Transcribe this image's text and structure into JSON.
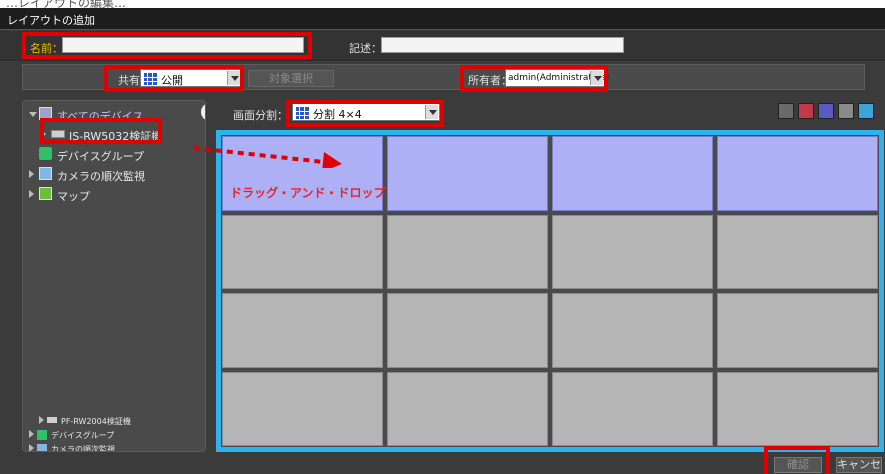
{
  "window": {
    "title": "レイアウトの追加"
  },
  "top_caption": "…レイアウトの編集…",
  "form": {
    "name_label": "名前：",
    "name_value": "",
    "description_label": "記述：",
    "description_value": "",
    "share_label": "共有：",
    "share_value": "公開",
    "target_button": "対象選択",
    "owner_label": "所有者：",
    "owner_value": "admin(Administrators)"
  },
  "tree": {
    "items": [
      {
        "label": "すべてのデバイス",
        "icon": "server-icon",
        "expanded": true
      },
      {
        "label": "JS-RW5032検証機",
        "icon": "camera-device-icon"
      },
      {
        "label": "デバイスグループ",
        "icon": "cube-icon"
      },
      {
        "label": "カメラの順次監視",
        "icon": "sequence-icon"
      },
      {
        "label": "マップ",
        "icon": "map-icon"
      }
    ],
    "bottom_items": [
      {
        "label": "PF-RW2004検証機",
        "icon": "camera-device-icon"
      },
      {
        "label": "デバイスグループ",
        "icon": "cube-icon"
      },
      {
        "label": "カメラの順次監視",
        "icon": "sequence-icon"
      }
    ]
  },
  "layout": {
    "split_label": "画面分割：",
    "split_value": "分割 4×4",
    "rows": 4,
    "cols": 4,
    "selected_row": 0
  },
  "annotation": {
    "drag_drop": "ドラッグ・アンド・ドロップ",
    "color": "#e8242b"
  },
  "footer": {
    "confirm": "確認",
    "cancel": "キャンセル"
  },
  "colors": {
    "highlight_frame": "#30b2ef",
    "selected_cell": "#aeb0f5",
    "callout": "#e00000"
  }
}
